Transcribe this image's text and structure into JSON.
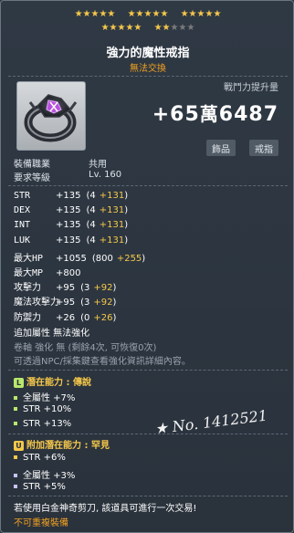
{
  "stars": {
    "row1_filled": 15,
    "row2_filled": 7,
    "row2_total": 10,
    "star_char": "★"
  },
  "item": {
    "name": "強力的魔性戒指",
    "trade_status": "無法交換"
  },
  "combat_power": {
    "label": "戰鬥力提升量",
    "value": "+65萬6487",
    "value_sign": "+",
    "value_wan": "65",
    "value_unit": "萬",
    "value_rest": "6487"
  },
  "tags": [
    "飾品",
    "戒指"
  ],
  "requirements": [
    {
      "label": "裝備職業",
      "value": "共用"
    },
    {
      "label": "要求等級",
      "value": "Lv. 160"
    }
  ],
  "stats": [
    {
      "name": "STR",
      "total": "+135",
      "base": "(4",
      "bonus": "+131",
      "close": ")"
    },
    {
      "name": "DEX",
      "total": "+135",
      "base": "(4",
      "bonus": "+131",
      "close": ")"
    },
    {
      "name": "INT",
      "total": "+135",
      "base": "(4",
      "bonus": "+131",
      "close": ")"
    },
    {
      "name": "LUK",
      "total": "+135",
      "base": "(4",
      "bonus": "+131",
      "close": ")"
    },
    {
      "name": "最大HP",
      "total": "+1055",
      "base": "(800",
      "bonus": "+255",
      "close": ")"
    },
    {
      "name": "最大MP",
      "total": "+800",
      "base": "",
      "bonus": "",
      "close": ""
    },
    {
      "name": "攻擊力",
      "total": "+95",
      "base": "(3",
      "bonus": "+92",
      "close": ")"
    },
    {
      "name": "魔法攻擊力",
      "total": "+95",
      "base": "(3",
      "bonus": "+92",
      "close": ")"
    },
    {
      "name": "防禦力",
      "total": "+26",
      "base": "(0",
      "bonus": "+26",
      "close": ")"
    }
  ],
  "extra": {
    "additional_attr": "追加屬性 無法強化",
    "scroll_line": "卷軸 強化 無 (剩餘4次, 可恢復0次)",
    "npc_line": "可透過NPC/採集鍵查看強化資訊詳細內容。"
  },
  "potential": {
    "badge": "L",
    "label": "潛在能力",
    "grade": "傳說",
    "lines": [
      "全屬性 +7%",
      "STR +10%",
      "STR +13%"
    ],
    "color": "#b8e86c"
  },
  "additional_potential": {
    "badge": "U",
    "label": "附加潛在能力",
    "grade": "罕見",
    "lines": [
      "STR +6%",
      "全屬性 +3%",
      "STR +5%"
    ],
    "color": "#f6c84a"
  },
  "handwritten": "★ No. 1412521",
  "bottom": {
    "scissors_line": "若使用白金神奇剪刀, 該道具可進行一次交易!",
    "no_reroll_line": "不可重複裝備"
  }
}
